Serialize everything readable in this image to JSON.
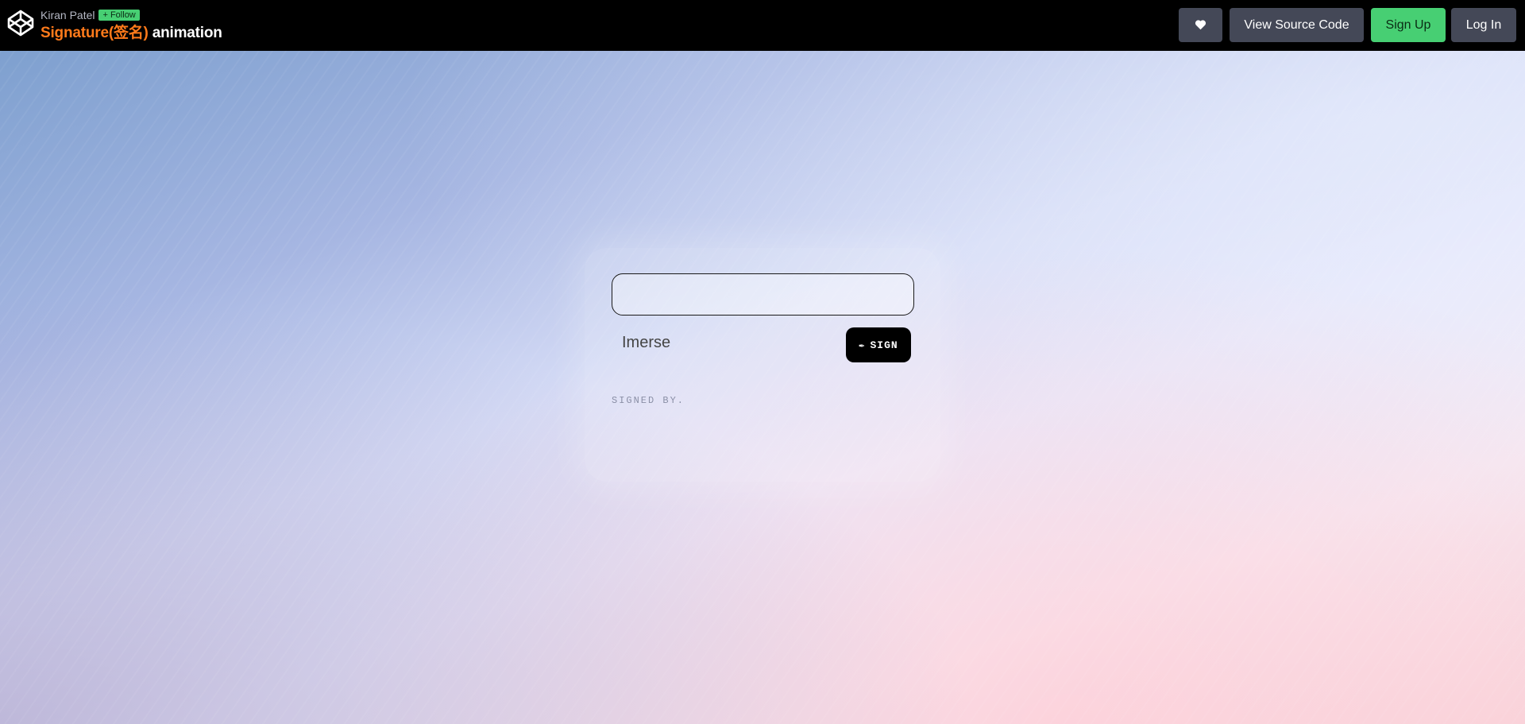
{
  "header": {
    "author": "Kiran Patel",
    "follow_label": "+ Follow",
    "title_main": "Signature(签名)",
    "title_rest": " animation",
    "buttons": {
      "view_source": "View Source Code",
      "sign_up": "Sign Up",
      "log_in": "Log In"
    }
  },
  "icons": {
    "logo": "codepen-logo-icon",
    "heart": "heart-icon",
    "pen": "pen-icon"
  },
  "signature_form": {
    "input_value": "Imerse",
    "sign_label": "SIGN",
    "signed_by_label": "SIGNED BY."
  },
  "colors": {
    "topbar_bg": "#000000",
    "title_accent": "#ff7a1a",
    "sign_up_bg": "#47cf73",
    "button_bg": "#444857"
  }
}
